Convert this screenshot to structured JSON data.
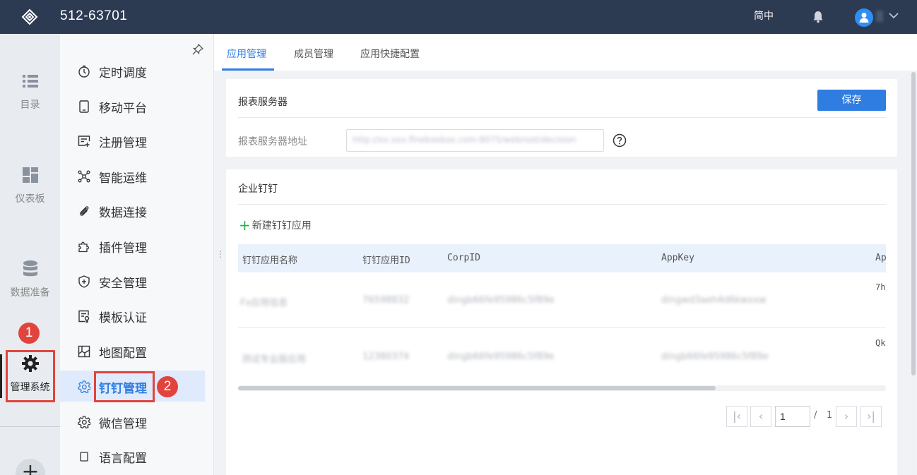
{
  "header": {
    "title": "512-63701",
    "language": "简中"
  },
  "rail": {
    "items": [
      {
        "label": "目录",
        "icon": "list-icon"
      },
      {
        "label": "仪表板",
        "icon": "dashboard-icon"
      },
      {
        "label": "数据准备",
        "icon": "database-icon"
      },
      {
        "label": "管理系统",
        "icon": "gear-icon"
      }
    ],
    "add_label": "+"
  },
  "annotations": {
    "step1": "1",
    "step2": "2"
  },
  "submenu": {
    "items": [
      {
        "label": "定时调度",
        "icon": "timer-icon"
      },
      {
        "label": "移动平台",
        "icon": "tablet-icon"
      },
      {
        "label": "注册管理",
        "icon": "register-icon"
      },
      {
        "label": "智能运维",
        "icon": "network-icon"
      },
      {
        "label": "数据连接",
        "icon": "paperclip-icon"
      },
      {
        "label": "插件管理",
        "icon": "puzzle-icon"
      },
      {
        "label": "安全管理",
        "icon": "shield-icon"
      },
      {
        "label": "模板认证",
        "icon": "certificate-icon"
      },
      {
        "label": "地图配置",
        "icon": "map-icon"
      },
      {
        "label": "钉钉管理",
        "icon": "gear-outline-icon"
      },
      {
        "label": "微信管理",
        "icon": "gear-outline-icon"
      },
      {
        "label": "语言配置",
        "icon": "square-icon"
      }
    ]
  },
  "tabs": [
    "应用管理",
    "成员管理",
    "应用快捷配置"
  ],
  "server": {
    "section_title": "报表服务器",
    "save_label": "保存",
    "address_label": "报表服务器地址",
    "address_value": "http://xx.xxx.fineboxbox.com:8075/webroot/decision"
  },
  "dingtalk": {
    "section_title": "企业钉钉",
    "new_app_label": "新建钉钉应用",
    "columns": [
      "钉钉应用名称",
      "钉钉应用ID",
      "CorpID",
      "AppKey",
      "Ap"
    ],
    "rows": [
      {
        "name": "Fx应用信息",
        "id": "76598832",
        "corp": "dingb66fe95986c5f89e",
        "appkey": "dingwd3aeh4d6kwxxw",
        "extra": "7h"
      },
      {
        "name": "测试专业版应用",
        "id": "12380374",
        "corp": "dingb66fe95986c5f89e",
        "appkey": "dingb66fe95986c5f89e",
        "extra": "Qk"
      }
    ]
  },
  "pager": {
    "first": "|‹",
    "prev": "‹",
    "current_page": "1",
    "separator": "/",
    "total_pages": "1",
    "next": "›",
    "last": "›|"
  }
}
